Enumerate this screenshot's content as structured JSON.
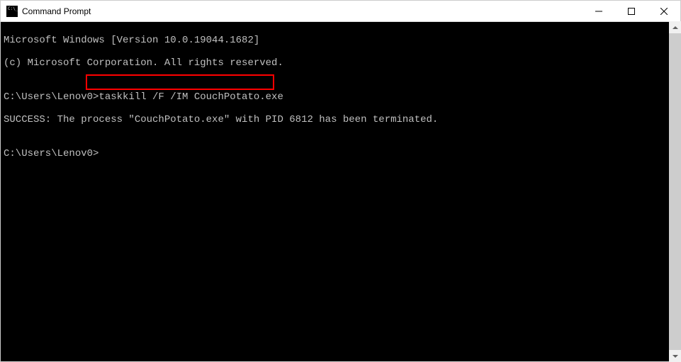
{
  "window": {
    "title": "Command Prompt"
  },
  "terminal": {
    "line1": "Microsoft Windows [Version 10.0.19044.1682]",
    "line2": "(c) Microsoft Corporation. All rights reserved.",
    "line3": "",
    "prompt1_prefix": "C:\\Users\\Lenov0>",
    "prompt1_cmd": "taskkill /F /IM CouchPotato.exe",
    "line5": "SUCCESS: The process \"CouchPotato.exe\" with PID 6812 has been terminated.",
    "line6": "",
    "prompt2_prefix": "C:\\Users\\Lenov0>",
    "prompt2_cmd": ""
  }
}
